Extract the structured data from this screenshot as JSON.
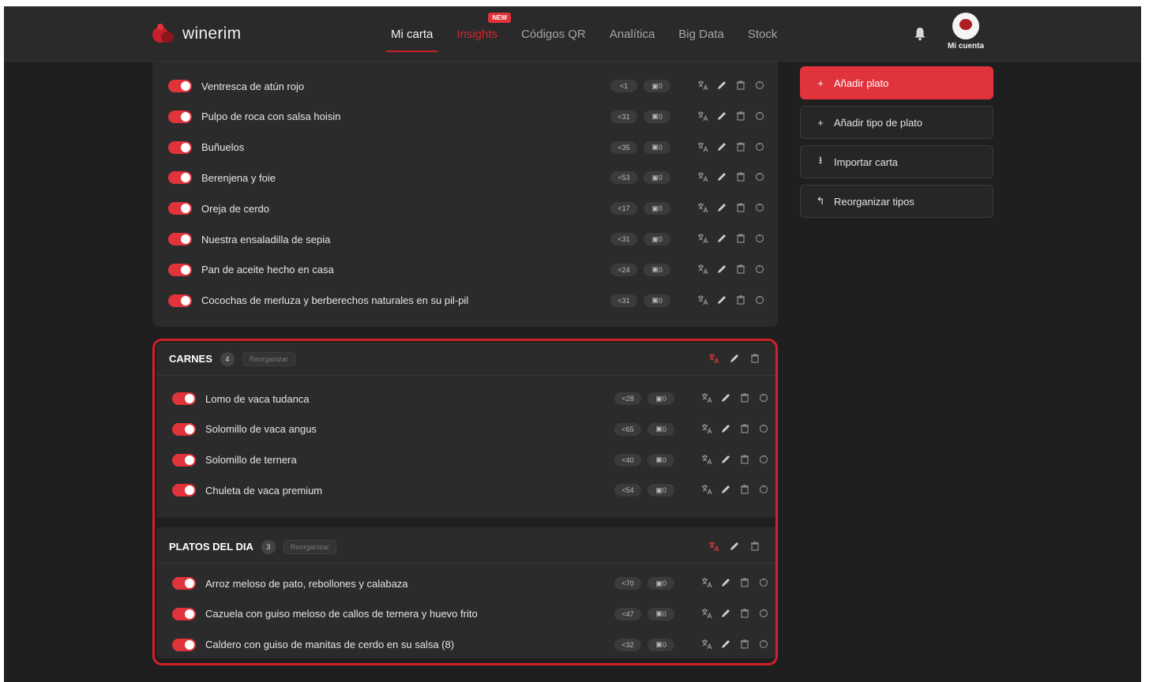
{
  "brand": {
    "name": "winerim"
  },
  "nav": {
    "items": [
      {
        "label": "Mi carta",
        "active": true
      },
      {
        "label": "Insights",
        "badge": "NEW"
      },
      {
        "label": "Códigos QR"
      },
      {
        "label": "Analítica"
      },
      {
        "label": "Big Data"
      },
      {
        "label": "Stock"
      }
    ],
    "account_label": "Mi cuenta"
  },
  "colors": {
    "accent": "#e1333b",
    "highlight": "#d0202a",
    "background": "#1f1f1f",
    "panel": "#2b2b2b"
  },
  "top_section": {
    "dishes": [
      {
        "name": "Ventresca de atún rojo",
        "views": "1",
        "stock": "0"
      },
      {
        "name": "Pulpo de roca con salsa hoisin",
        "views": "31",
        "stock": "0"
      },
      {
        "name": "Buñuelos",
        "views": "35",
        "stock": "0"
      },
      {
        "name": "Berenjena y foie",
        "views": "53",
        "stock": "0"
      },
      {
        "name": "Oreja de cerdo",
        "views": "17",
        "stock": "0"
      },
      {
        "name": "Nuestra ensaladilla de sepia",
        "views": "31",
        "stock": "0"
      },
      {
        "name": "Pan de aceite hecho en casa",
        "views": "24",
        "stock": "0"
      },
      {
        "name": "Cocochas de merluza y berberechos naturales en su pil-pil",
        "views": "31",
        "stock": "0"
      }
    ]
  },
  "carnes": {
    "title": "CARNES",
    "count": "4",
    "reorder_label": "Reorganizar",
    "dishes": [
      {
        "name": "Lomo de vaca tudanca",
        "views": "28",
        "stock": "0"
      },
      {
        "name": "Solomillo de vaca angus",
        "views": "65",
        "stock": "0"
      },
      {
        "name": "Solomillo de ternera",
        "views": "40",
        "stock": "0"
      },
      {
        "name": "Chuleta de vaca premium",
        "views": "54",
        "stock": "0"
      }
    ]
  },
  "platos_dia": {
    "title": "PLATOS DEL DIA",
    "count": "3",
    "reorder_label": "Reorganizar",
    "dishes": [
      {
        "name": "Arroz meloso de pato, rebollones y calabaza",
        "views": "70",
        "stock": "0"
      },
      {
        "name": "Cazuela con guiso meloso de callos de ternera y huevo frito",
        "views": "47",
        "stock": "0"
      },
      {
        "name": "Caldero con guiso de manitas de cerdo en su salsa (8)",
        "views": "32",
        "stock": "0"
      }
    ]
  },
  "sidebar": {
    "add_dish": "Añadir plato",
    "add_type": "Añadir tipo de plato",
    "import": "Importar carta",
    "reorder": "Reorganizar tipos"
  },
  "icons": [
    "bell-icon",
    "translate-icon",
    "edit-icon",
    "trash-icon",
    "duplicate-icon",
    "plus-icon",
    "import-icon",
    "reorder-icon"
  ]
}
